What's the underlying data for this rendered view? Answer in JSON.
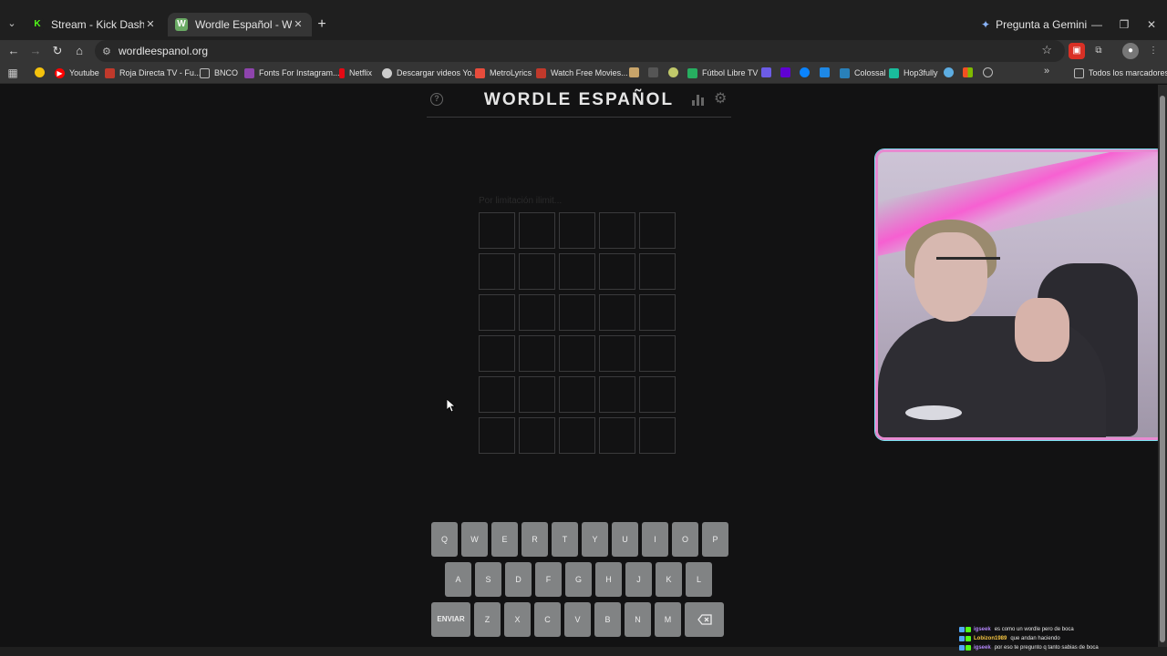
{
  "browser": {
    "tabs": [
      {
        "title": "Stream - Kick Dashboard",
        "favicon": "K",
        "favicon_color": "#53fc18",
        "active": false
      },
      {
        "title": "Wordle Español - Wordle ilimitado",
        "favicon": "W",
        "favicon_color": "#6aaa64",
        "active": true
      }
    ],
    "gemini_label": "Pregunta a Gemini",
    "url": "wordleespanol.org",
    "bookmarks": [
      {
        "label": "Youtube",
        "color": "#ff0000"
      },
      {
        "label": "Roja Directa TV - Fu...",
        "color": "#c0392b"
      },
      {
        "label": "BNCO",
        "color": "#888888"
      },
      {
        "label": "Fonts For Instagram...",
        "color": "#8e44ad"
      },
      {
        "label": "Netflix",
        "color": "#e50914"
      },
      {
        "label": "Descargar videos Yo...",
        "color": "#cccccc"
      },
      {
        "label": "MetroLyrics",
        "color": "#e74c3c"
      },
      {
        "label": "Watch Free Movies...",
        "color": "#c0392b"
      },
      {
        "label": "Fútbol Libre TV",
        "color": "#27ae60"
      },
      {
        "label": "Colossal",
        "color": "#2980b9"
      },
      {
        "label": "Hop3fully",
        "color": "#1abc9c"
      },
      {
        "label": "Todos los marcadores",
        "color": "#aaaaaa"
      }
    ]
  },
  "wordle": {
    "title": "WORDLE ESPAÑOL",
    "faint_text": "Por limitación ilimit...",
    "rows": 6,
    "cols": 5,
    "keyboard": {
      "row1": [
        "Q",
        "W",
        "E",
        "R",
        "T",
        "Y",
        "U",
        "I",
        "O",
        "P"
      ],
      "row2": [
        "A",
        "S",
        "D",
        "F",
        "G",
        "H",
        "J",
        "K",
        "L"
      ],
      "row3": [
        "ENVIAR",
        "Z",
        "X",
        "C",
        "V",
        "B",
        "N",
        "M",
        "⌫"
      ]
    }
  },
  "chat": [
    {
      "user": "igseek",
      "user_color": "#b084f5",
      "message": "es como un wordle pero de boca"
    },
    {
      "user": "Lobizon1989",
      "user_color": "#f5c542",
      "message": "que andan haciendo"
    },
    {
      "user": "igseek",
      "user_color": "#b084f5",
      "message": "por eso te pregunto q tanto sabias de boca"
    }
  ]
}
